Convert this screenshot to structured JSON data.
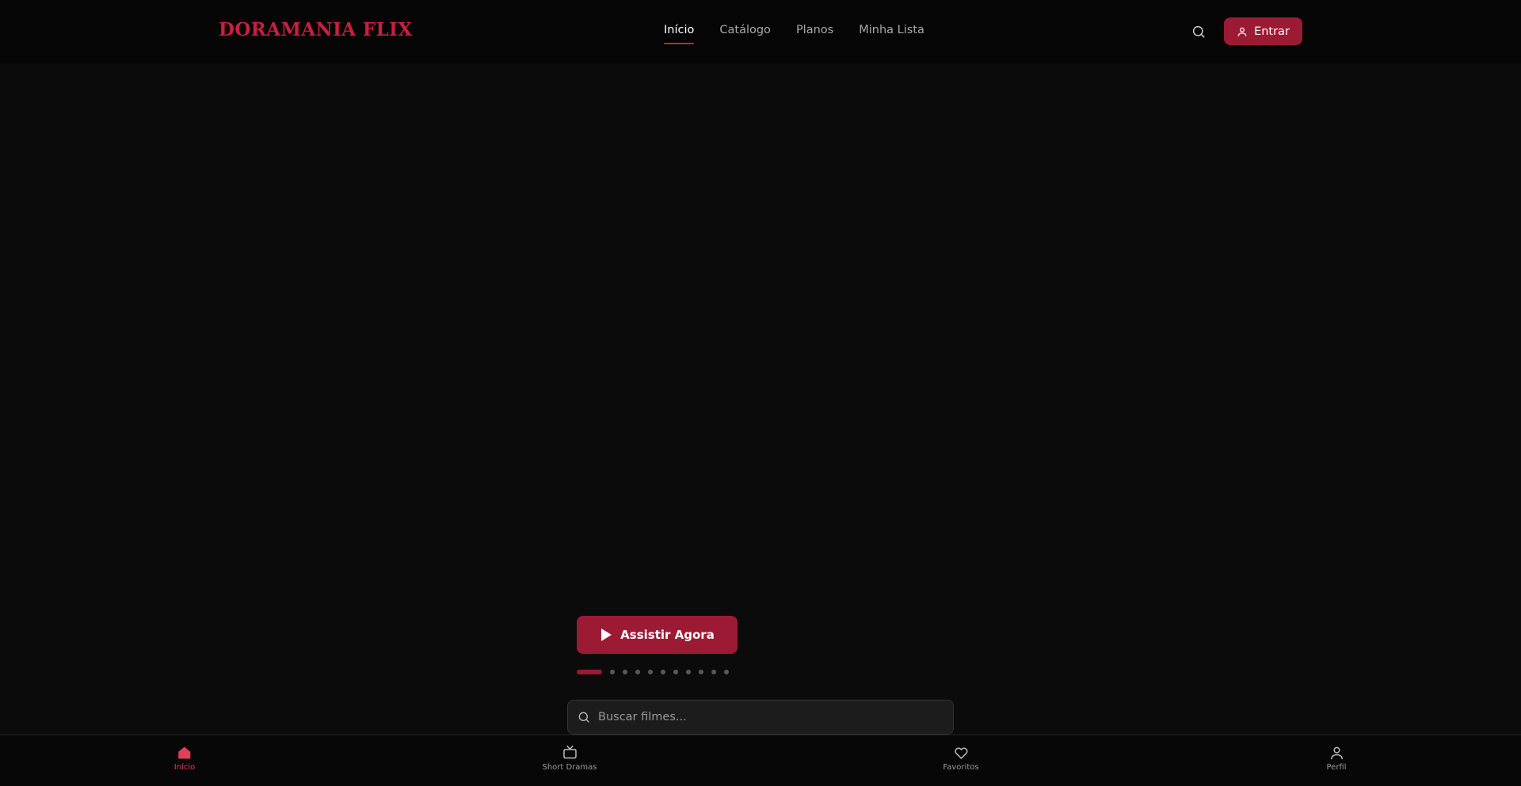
{
  "header": {
    "logo": "DORAMANIA FLIX",
    "nav": [
      {
        "label": "Início",
        "active": true
      },
      {
        "label": "Catálogo",
        "active": false
      },
      {
        "label": "Planos",
        "active": false
      },
      {
        "label": "Minha Lista",
        "active": false
      }
    ],
    "search_icon": "search-icon",
    "login_label": "Entrar",
    "login_icon": "user-icon"
  },
  "hero": {
    "watch_label": "Assistir Agora",
    "watch_icon": "play-icon",
    "carousel": {
      "total": 11,
      "active_index": 0
    }
  },
  "search": {
    "placeholder": "Buscar filmes...",
    "value": ""
  },
  "bottom_nav": [
    {
      "label": "Início",
      "icon": "home-icon",
      "active": true
    },
    {
      "label": "Short Dramas",
      "icon": "tv-icon",
      "active": false
    },
    {
      "label": "Favoritos",
      "icon": "heart-icon",
      "active": false
    },
    {
      "label": "Perfil",
      "icon": "user-icon",
      "active": false
    }
  ],
  "colors": {
    "brand": "#c8203f",
    "button": "#9c1a34",
    "background": "#0b0b0b",
    "active_bottom": "#e0405a"
  }
}
